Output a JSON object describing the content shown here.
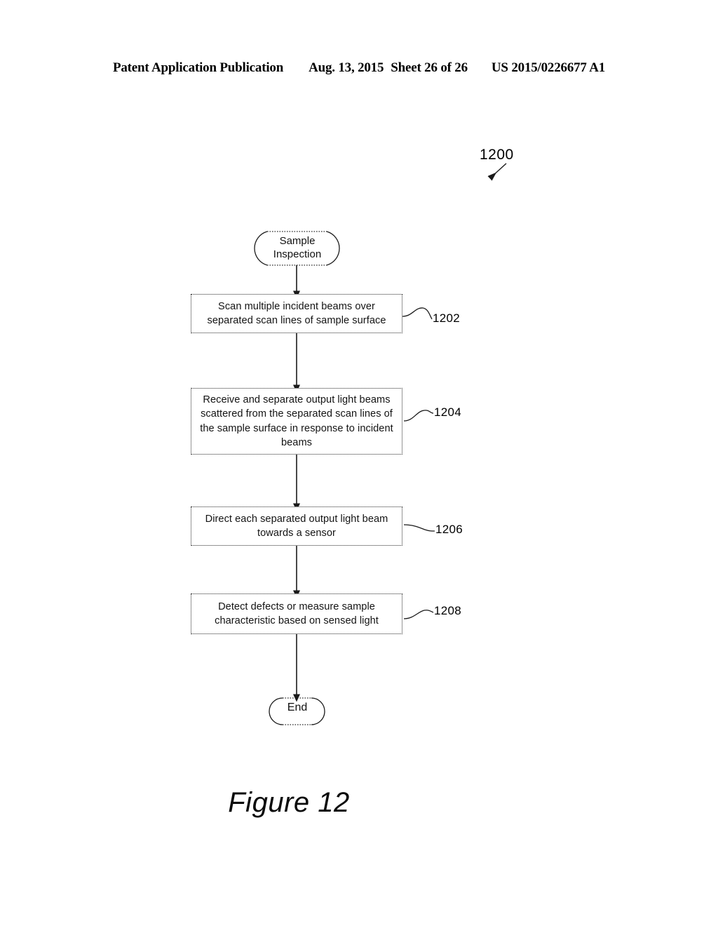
{
  "header": {
    "publication": "Patent Application Publication",
    "date": "Aug. 13, 2015",
    "sheet": "Sheet 26 of 26",
    "patent_number": "US 2015/0226677 A1"
  },
  "figure": {
    "caption": "Figure 12",
    "diagram_reference": "1200"
  },
  "flowchart": {
    "start_node": {
      "name": "sample-inspection",
      "line1": "Sample",
      "line2": "Inspection"
    },
    "steps": [
      {
        "ref": "1202",
        "name": "scan-beams",
        "lines": [
          "Scan multiple incident beams over",
          "separated scan lines of sample surface"
        ]
      },
      {
        "ref": "1204",
        "name": "receive-separate-beams",
        "lines": [
          "Receive and separate output light beams",
          "scattered from the separated scan lines of",
          "the sample surface in response to incident",
          "beams"
        ]
      },
      {
        "ref": "1206",
        "name": "direct-beam-to-sensor",
        "lines": [
          "Direct each separated output light beam",
          "towards a sensor"
        ]
      },
      {
        "ref": "1208",
        "name": "detect-defects",
        "lines": [
          "Detect defects or measure sample",
          "characteristic based on sensed light"
        ]
      }
    ],
    "end_node": {
      "name": "end",
      "label": "End"
    }
  },
  "colors": {
    "ink": "#000000",
    "page": "#ffffff",
    "box_border": "#2b2b2b"
  }
}
